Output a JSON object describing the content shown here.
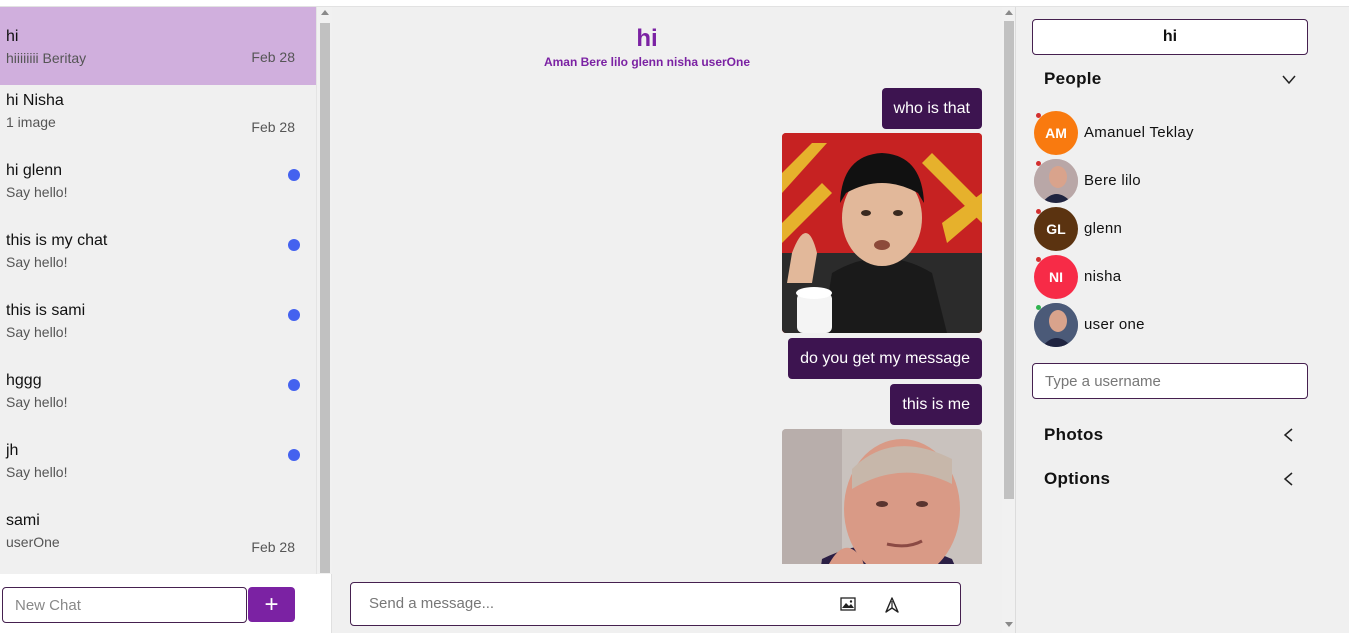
{
  "chats": [
    {
      "name": "hi",
      "preview": "hiiiiiiii Beritay",
      "date": "Feb 28",
      "unread": false,
      "active": true
    },
    {
      "name": "hi Nisha",
      "preview": "1 image",
      "date": "Feb 28",
      "unread": false,
      "active": false
    },
    {
      "name": "hi glenn",
      "preview": "Say hello!",
      "date": "",
      "unread": true,
      "active": false
    },
    {
      "name": "this is my chat",
      "preview": "Say hello!",
      "date": "",
      "unread": true,
      "active": false
    },
    {
      "name": "this is sami",
      "preview": "Say hello!",
      "date": "",
      "unread": true,
      "active": false
    },
    {
      "name": "hggg",
      "preview": "Say hello!",
      "date": "",
      "unread": true,
      "active": false
    },
    {
      "name": "jh",
      "preview": "Say hello!",
      "date": "",
      "unread": true,
      "active": false
    },
    {
      "name": "sami",
      "preview": "userOne",
      "date": "Feb 28",
      "unread": false,
      "active": false
    }
  ],
  "new_chat": {
    "placeholder": "New Chat",
    "add_label": "+"
  },
  "conversation": {
    "title": "hi",
    "members": "Aman Bere lilo glenn nisha userOne",
    "messages": [
      {
        "type": "text",
        "text": "who is that"
      },
      {
        "type": "image",
        "alt": "photo of a man in black suit"
      },
      {
        "type": "text",
        "text": "do you get my message"
      },
      {
        "type": "text",
        "text": "this is me"
      },
      {
        "type": "image",
        "alt": "photo of a man in dark suit pointing"
      }
    ],
    "input_placeholder": "Send a message..."
  },
  "settings": {
    "chat_title": "hi",
    "people_label": "People",
    "people": [
      {
        "initials": "AM",
        "name": "Amanuel Teklay",
        "color": "#f97a0f",
        "photo": false,
        "status_color": "#d32f2f"
      },
      {
        "initials": "",
        "name": "Bere lilo",
        "color": "#b9a7a7",
        "photo": true,
        "status_color": "#d32f2f"
      },
      {
        "initials": "GL",
        "name": "glenn",
        "color": "#5b3310",
        "photo": false,
        "status_color": "#d32f2f"
      },
      {
        "initials": "NI",
        "name": "nisha",
        "color": "#f72b47",
        "photo": false,
        "status_color": "#d32f2f"
      },
      {
        "initials": "",
        "name": "user one",
        "color": "#4b5a78",
        "photo": true,
        "status_color": "#2fb34f"
      }
    ],
    "username_placeholder": "Type a username",
    "photos_label": "Photos",
    "options_label": "Options"
  },
  "colors": {
    "accent": "#7b22a3",
    "bubble": "#3d1450",
    "active_chat": "#d0afdd",
    "unread_dot": "#4462ef"
  }
}
